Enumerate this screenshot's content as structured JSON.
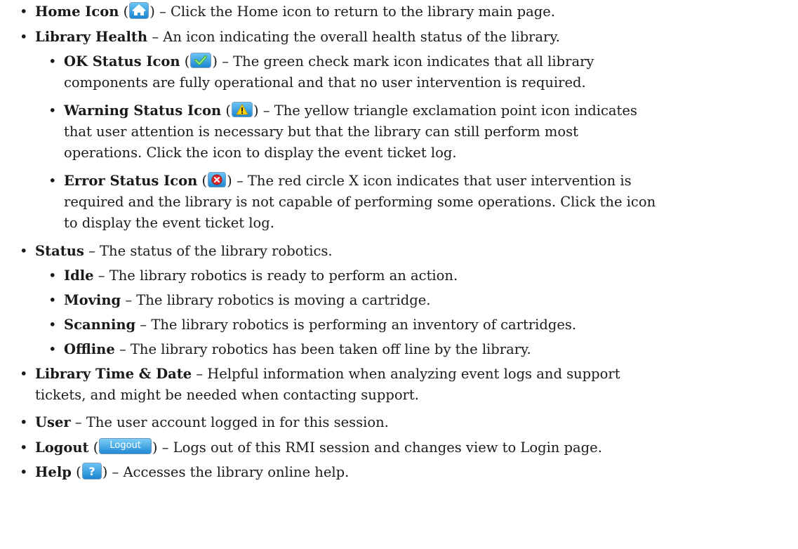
{
  "bullet": "•",
  "items": {
    "home": {
      "term": "Home Icon",
      "pre": " (",
      "post": ") – Click the Home icon to return to the library main page.",
      "icon": "home-icon"
    },
    "health": {
      "term": "Library Health",
      "text": " – An icon indicating the overall health status of the library.",
      "ok": {
        "term": "OK Status Icon",
        "pre": " (",
        "post_1": ") – The green check mark icon indicates that all library",
        "line_2": "components are fully operational and that no user intervention is required.",
        "icon": "check-icon"
      },
      "warning": {
        "term": "Warning Status Icon",
        "pre": " (",
        "post_1": ") – The yellow triangle exclamation point icon indicates",
        "line_2": "that user attention is necessary but that the library can still perform most",
        "line_3": "operations. Click the icon to display the event ticket log.",
        "icon": "warning-icon"
      },
      "error": {
        "term": "Error Status Icon",
        "pre": " (",
        "post_1": ") – The red circle X icon indicates that user intervention is",
        "line_2": "required and the library is not capable of performing some operations. Click the icon",
        "line_3": "to display the event ticket log.",
        "icon": "error-icon"
      }
    },
    "status": {
      "term": "Status",
      "text": " – The status of the library robotics.",
      "idle": {
        "term": "Idle",
        "text": " – The library robotics is ready to perform an action."
      },
      "moving": {
        "term": "Moving",
        "text": " – The library robotics is moving a cartridge."
      },
      "scanning": {
        "term": "Scanning",
        "text": " – The library robotics is performing an inventory of cartridges."
      },
      "offline": {
        "term": "Offline",
        "text": " – The library robotics has been taken off line by the library."
      }
    },
    "time": {
      "term": "Library Time & Date",
      "text_1": " – Helpful information when analyzing event logs and support",
      "line_2": "tickets, and might be needed when contacting support."
    },
    "user": {
      "term": "User",
      "text": " – The user account logged in for this session."
    },
    "logout": {
      "term": "Logout",
      "pre": " (",
      "button_label": "Logout",
      "post": ") – Logs out of this RMI session and changes view to Login page."
    },
    "help": {
      "term": "Help",
      "pre": " (",
      "post": ") – Accesses the library online help.",
      "icon": "help-icon",
      "glyph": "?"
    }
  },
  "colors": {
    "icon_blue_top": "#6cc4f4",
    "icon_blue_bottom": "#1b86d2",
    "check_green": "#3cb43c",
    "warning_yellow": "#ffd400",
    "error_red": "#e02a2a"
  }
}
